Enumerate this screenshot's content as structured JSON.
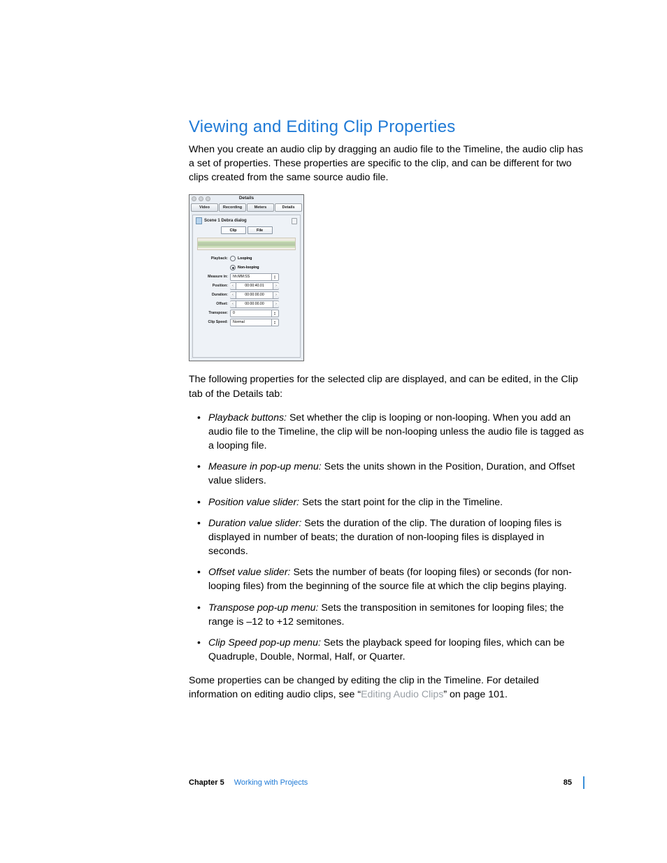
{
  "heading": "Viewing and Editing Clip Properties",
  "intro": "When you create an audio clip by dragging an audio file to the Timeline, the audio clip has a set of properties. These properties are specific to the clip, and can be different for two clips created from the same source audio file.",
  "lead_out": "The following properties for the selected clip are displayed, and can be edited, in the Clip tab of the Details tab:",
  "props": [
    {
      "term": "Playback buttons:",
      "desc": "  Set whether the clip is looping or non-looping. When you add an audio file to the Timeline, the clip will be non-looping unless the audio file is tagged as a looping file."
    },
    {
      "term": "Measure in pop-up menu:",
      "desc": "  Sets the units shown in the Position, Duration, and Offset value sliders."
    },
    {
      "term": "Position value slider:",
      "desc": "  Sets the start point for the clip in the Timeline."
    },
    {
      "term": "Duration value slider:",
      "desc": "  Sets the duration of the clip. The duration of looping files is displayed in number of beats; the duration of non-looping files is displayed in seconds."
    },
    {
      "term": "Offset value slider:",
      "desc": "  Sets the number of beats (for looping files) or seconds (for non-looping files) from the beginning of the source file at which the clip begins playing."
    },
    {
      "term": "Transpose pop-up menu:",
      "desc": "  Sets the transposition in semitones for looping files; the range is –12 to +12 semitones."
    },
    {
      "term": "Clip Speed pop-up menu:",
      "desc": "  Sets the playback speed for looping files, which can be Quadruple, Double, Normal, Half, or Quarter."
    }
  ],
  "outro_a": "Some properties can be changed by editing the clip in the Timeline. For detailed information on editing audio clips, see “",
  "outro_link": "Editing Audio Clips",
  "outro_b": "” on page 101.",
  "footer": {
    "chapter": "Chapter 5",
    "title": "Working with Projects",
    "page": "85"
  },
  "shot": {
    "title": "Details",
    "tabs": [
      "Video",
      "Recording",
      "Meters",
      "Details"
    ],
    "clip": "Scene 1 Debra dialog",
    "subtabs": [
      "Clip",
      "File"
    ],
    "labels": {
      "playback": "Playback:",
      "looping": "Looping",
      "nonlooping": "Non-looping",
      "measure": "Measure in:",
      "measure_v": "hh:MM:SS",
      "position": "Position:",
      "position_v": "00:00:40.01",
      "duration": "Duration:",
      "duration_v": "00:00:00.00",
      "offset": "Offset:",
      "offset_v": "00:00:00.00",
      "transpose": "Transpose:",
      "transpose_v": "0",
      "speed": "Clip Speed:",
      "speed_v": "Normal"
    }
  }
}
